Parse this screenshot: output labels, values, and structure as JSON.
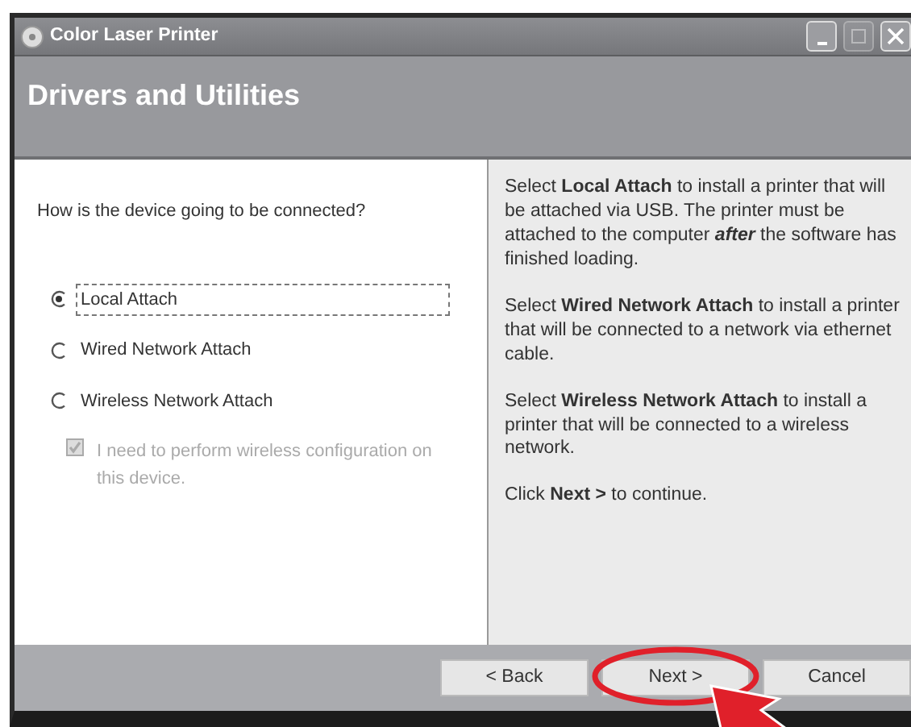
{
  "window": {
    "title": "Color Laser Printer",
    "controls": [
      {
        "kind": "minimize",
        "disabled": false
      },
      {
        "kind": "maximize",
        "disabled": true
      },
      {
        "kind": "close",
        "disabled": false
      }
    ]
  },
  "header": {
    "title": "Drivers and Utilities"
  },
  "question": "How is the device going to be connected?",
  "options": [
    {
      "kind": "radio",
      "label": "Local Attach",
      "selected": true,
      "focused": true,
      "disabled": false
    },
    {
      "kind": "radio",
      "label": "Wired Network Attach",
      "selected": false,
      "focused": false,
      "disabled": false
    },
    {
      "kind": "radio",
      "label": "Wireless Network Attach",
      "selected": false,
      "focused": false,
      "disabled": false
    },
    {
      "kind": "checkbox",
      "label": "I need to perform wireless configuration on this device.",
      "checked": true,
      "focused": false,
      "disabled": true
    }
  ],
  "help": [
    "Select **Local Attach** to install a printer that will be attached via USB. The printer must be attached to the computer *after* the software has finished loading.",
    "Select **Wired Network Attach** to install a printer that will be connected to a network via ethernet cable.",
    "Select **Wireless Network Attach** to install a printer that will be connected to a wireless network.",
    "Click **Next >** to continue."
  ],
  "buttons": [
    {
      "label": "< Back",
      "highlighted": false
    },
    {
      "label": "Next >",
      "highlighted": true
    },
    {
      "label": "Cancel",
      "highlighted": false
    }
  ]
}
